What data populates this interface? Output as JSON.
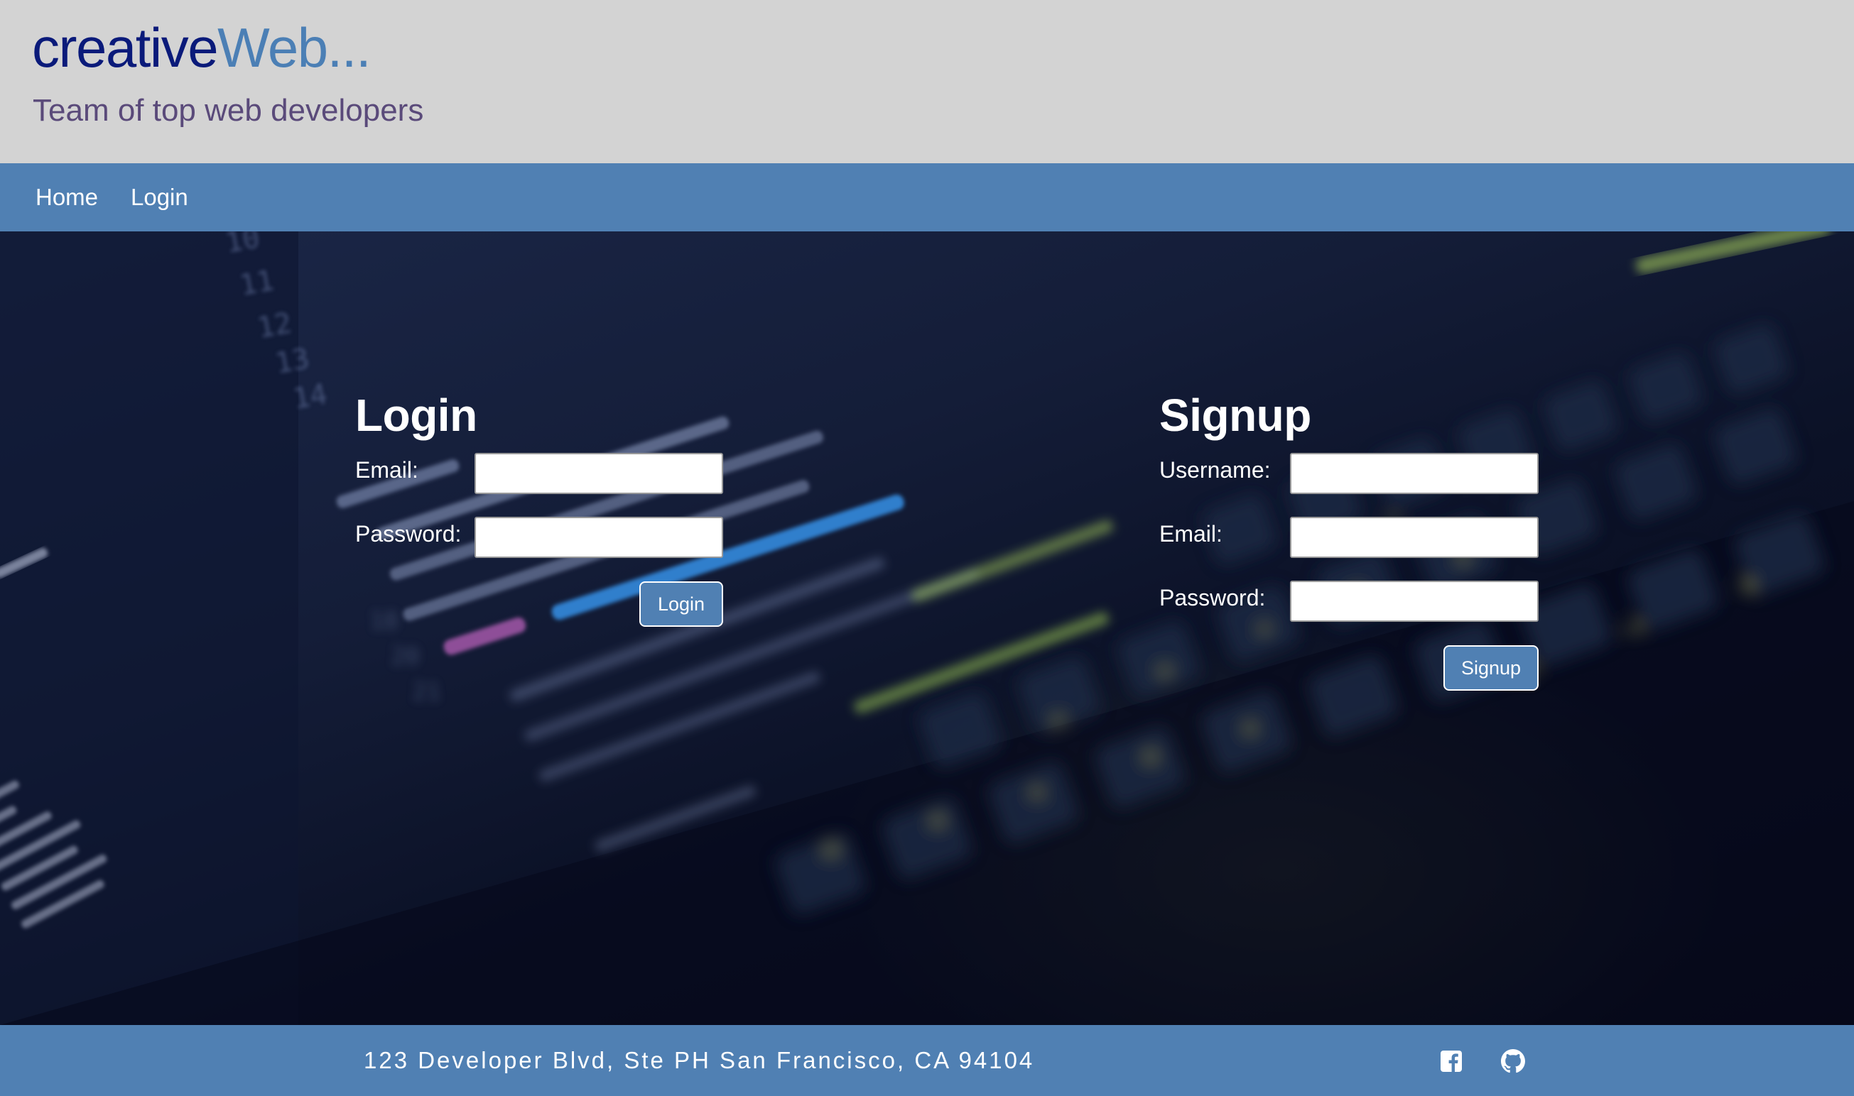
{
  "header": {
    "brand_primary": "creative",
    "brand_secondary": "Web...",
    "tagline": "Team of top web developers"
  },
  "nav": {
    "items": [
      {
        "label": "Home"
      },
      {
        "label": "Login"
      }
    ]
  },
  "login": {
    "title": "Login",
    "email_label": "Email:",
    "email_value": "",
    "password_label": "Password:",
    "password_value": "",
    "button_label": "Login"
  },
  "signup": {
    "title": "Signup",
    "username_label": "Username:",
    "username_value": "",
    "email_label": "Email:",
    "email_value": "",
    "password_label": "Password:",
    "password_value": "",
    "button_label": "Signup"
  },
  "footer": {
    "address": "123 Developer Blvd, Ste PH San Francisco, CA 94104",
    "social": [
      {
        "icon": "facebook-icon"
      },
      {
        "icon": "github-icon"
      }
    ]
  },
  "colors": {
    "header_bg": "#d3d3d3",
    "brand_dark": "#0a1a7a",
    "brand_light": "#4b7fb5",
    "tagline": "#5a4a7a",
    "nav_bg": "#5080b3",
    "footer_bg": "#5080b3"
  }
}
